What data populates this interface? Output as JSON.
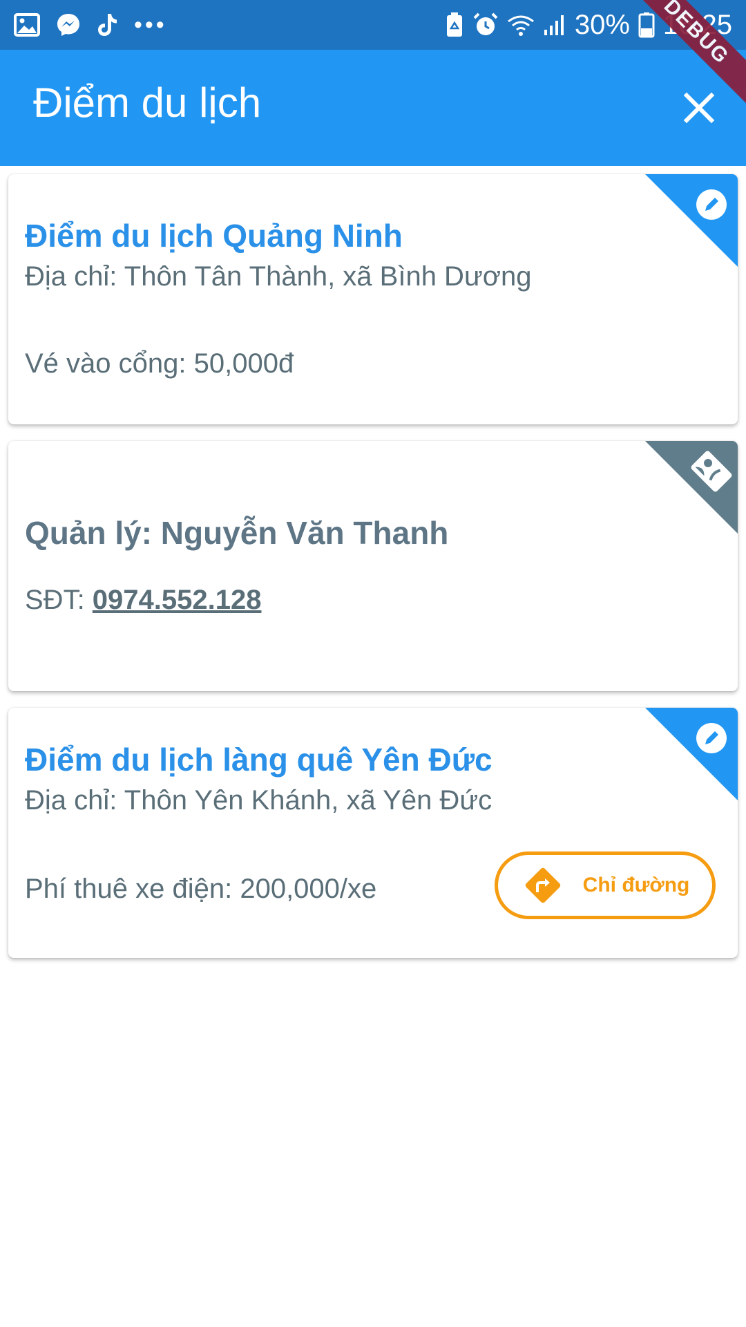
{
  "status_bar": {
    "battery": "30%",
    "time": "16:25",
    "left_icons": [
      "gallery-icon",
      "messenger-icon",
      "tiktok-icon",
      "more-dots-icon"
    ],
    "right_icons": [
      "recycle-icon",
      "alarm-icon",
      "wifi-icon",
      "signal-icon",
      "battery-icon"
    ]
  },
  "debug_banner": "DEBUG",
  "app_bar": {
    "title": "Điểm du lịch",
    "close_icon": "close-icon"
  },
  "cards": [
    {
      "title": "Điểm du lịch Quảng Ninh",
      "address": "Địa chỉ: Thôn Tân Thành, xã Bình Dương",
      "fee": "Vé vào cổng: 50,000đ",
      "corner_icon": "edit-icon",
      "corner_color": "#2196f3"
    },
    {
      "manager": "Quản lý: Nguyễn Văn Thanh",
      "phone_label": "SĐT: ",
      "phone_number": "0974.552.128",
      "corner_icon": "contact-phone-icon",
      "corner_color": "#607d8b"
    },
    {
      "title": "Điểm du lịch làng quê Yên Đức",
      "address": "Địa chỉ: Thôn Yên Khánh, xã Yên Đức",
      "fee": "Phí thuê xe điện: 200,000/xe",
      "corner_icon": "edit-icon",
      "corner_color": "#2196f3",
      "button_label": "Chỉ đường",
      "button_icon": "directions-icon",
      "button_color": "#f59c11"
    }
  ],
  "colors": {
    "status_bar": "#1f74c1",
    "app_bar": "#2196f3",
    "title_blue": "#2a90e8",
    "text_gray": "#5a6e78"
  }
}
